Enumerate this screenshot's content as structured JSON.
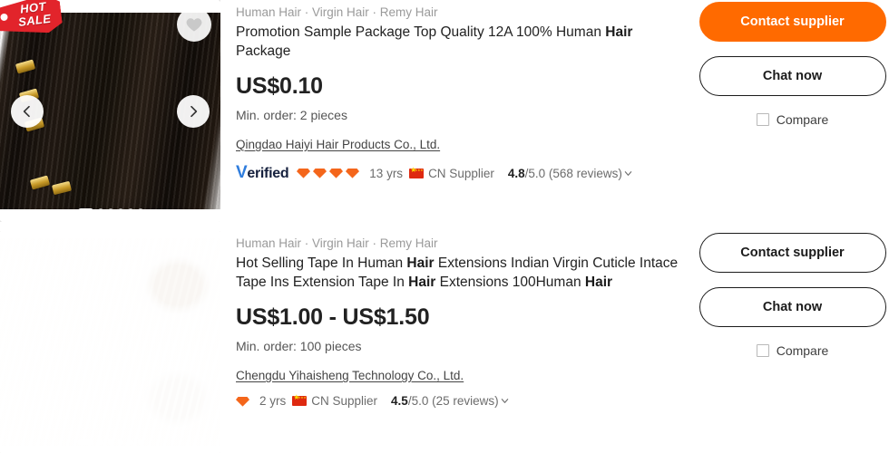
{
  "listings": [
    {
      "badge": {
        "line1": "HOT",
        "line2": "SALE"
      },
      "categories": "Human Hair · Virgin Hair · Remy Hair",
      "title_parts": [
        {
          "text": "Promotion Sample Package Top Quality 12A 100% Human ",
          "bold": false
        },
        {
          "text": "Hair",
          "bold": true
        },
        {
          "text": " Package",
          "bold": false
        }
      ],
      "price": "US$0.10",
      "min_order": "Min. order: 2 pieces",
      "supplier": "Qingdao Haiyi Hair Products Co., Ltd.",
      "verified_label": "Verified",
      "verified_v": "V",
      "verified_rest": "erified",
      "gem_count": 4,
      "years": "13 yrs",
      "country": "CN Supplier",
      "rating_score": "4.8",
      "rating_rest": "/5.0 (568 reviews)",
      "contact_label": "Contact supplier",
      "contact_style": "primary",
      "chat_label": "Chat now",
      "compare_label": "Compare",
      "dots_total": 6,
      "dots_active": 0
    },
    {
      "categories": "Human Hair · Virgin Hair · Remy Hair",
      "title_parts": [
        {
          "text": "Hot Selling Tape In Human ",
          "bold": false
        },
        {
          "text": "Hair",
          "bold": true
        },
        {
          "text": " Extensions Indian Virgin Cuticle Intace Tape Ins Extension Tape In ",
          "bold": false
        },
        {
          "text": "Hair",
          "bold": true
        },
        {
          "text": " Extensions 100Human ",
          "bold": false
        },
        {
          "text": "Hair",
          "bold": true
        }
      ],
      "price": "US$1.00 - US$1.50",
      "min_order": "Min. order: 100 pieces",
      "supplier": "Chengdu Yihaisheng Technology Co., Ltd.",
      "gem_count": 1,
      "years": "2 yrs",
      "country": "CN Supplier",
      "rating_score": "4.5",
      "rating_rest": "/5.0 (25 reviews)",
      "contact_label": "Contact supplier",
      "contact_style": "outline",
      "chat_label": "Chat now",
      "compare_label": "Compare",
      "dots_total": 6,
      "dots_active": 0
    }
  ],
  "colors": {
    "accent_orange": "#ff6a00",
    "badge_red": "#e2242b",
    "verified_blue": "#2f7ddd",
    "gem_orange": "#f4661b",
    "flag_red": "#de2910"
  }
}
